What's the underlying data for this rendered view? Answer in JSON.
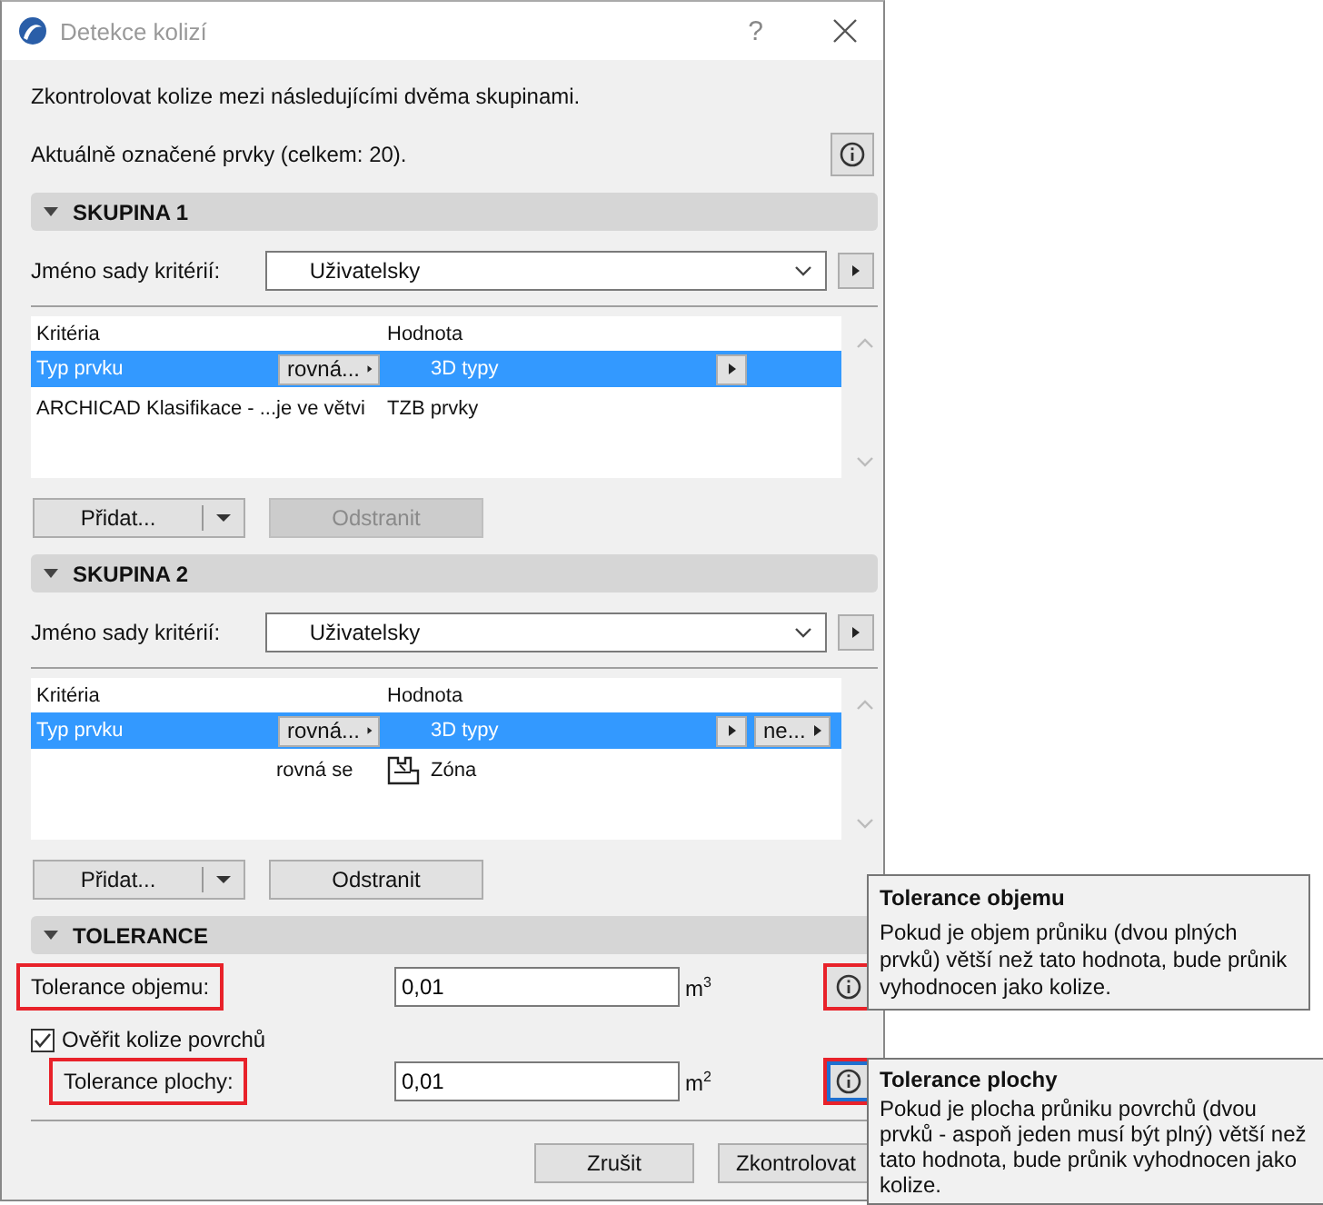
{
  "window": {
    "title": "Detekce kolizí",
    "help": "?"
  },
  "intro": "Zkontrolovat kolize mezi následujícími dvěma skupinami.",
  "selection_info": "Aktuálně označené prvky (celkem: 20).",
  "groups": [
    {
      "title": "SKUPINA 1",
      "expanded": true,
      "criteria_label": "Jméno sady kritérií:",
      "criteria_value": "Uživatelsky",
      "columns": [
        "Kritéria",
        "Hodnota"
      ],
      "rows": [
        {
          "criterion": "Typ prvku",
          "operator": "rovná...",
          "value": "3D typy",
          "selected": true
        },
        {
          "criterion": "ARCHICAD Klasifikace - ...",
          "operator": "je ve větvi",
          "value": "TZB prvky",
          "selected": false
        }
      ],
      "add": "Přidat...",
      "remove": {
        "label": "Odstranit",
        "disabled": true
      }
    },
    {
      "title": "SKUPINA 2",
      "expanded": true,
      "criteria_label": "Jméno sady kritérií:",
      "criteria_value": "Uživatelsky",
      "columns": [
        "Kritéria",
        "Hodnota"
      ],
      "rows": [
        {
          "criterion": "Typ prvku",
          "operator": "rovná...",
          "value": "3D typy",
          "extra": "ne...",
          "selected": true
        },
        {
          "operator": "rovná se",
          "value": "Zóna",
          "value_icon": true,
          "selected": false
        }
      ],
      "add": "Přidat...",
      "remove": {
        "label": "Odstranit",
        "disabled": false
      }
    }
  ],
  "tolerance": {
    "title": "TOLERANCE",
    "expanded": true,
    "items": [
      {
        "kind": "field",
        "label": "Tolerance objemu:",
        "value": "0,01",
        "unit": "m$^{3}$",
        "highlighted": true,
        "info_focused": false
      },
      {
        "kind": "checkbox",
        "label": "Ověřit kolize povrchů",
        "checked": true,
        "children": [
          {
            "kind": "field",
            "label": "Tolerance plochy:",
            "value": "0,01",
            "unit": "m$^{2}$",
            "highlighted": true,
            "info_focused": true
          }
        ]
      }
    ]
  },
  "buttons": [
    "Zrušit",
    "Zkontrolovat"
  ],
  "tooltips": [
    {
      "title": "Tolerance objemu",
      "text": "Pokud je objem průniku (dvou plných prvků) větší než tato hodnota, bude průnik vyhodnocen jako kolize."
    },
    {
      "title": "Tolerance plochy",
      "text": "Pokud je plocha průniku povrchů (dvou prvků - aspoň jeden musí být plný) větší než tato hodnota, bude průnik vyhodnocen jako kolize."
    }
  ]
}
